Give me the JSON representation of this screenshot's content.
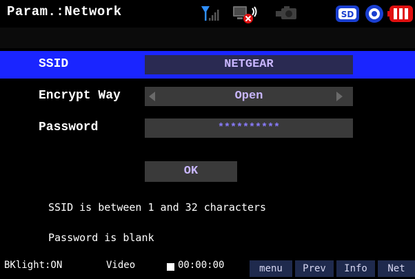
{
  "header": {
    "title": "Param.:Network",
    "icons": [
      "signal-icon",
      "monitor-disconnected-icon",
      "camera-icon",
      "sd-card-icon",
      "record-disc-icon",
      "battery-icon"
    ]
  },
  "form": {
    "ssid": {
      "label": "SSID",
      "value": "NETGEAR"
    },
    "encrypt": {
      "label": "Encrypt Way",
      "value": "Open"
    },
    "password": {
      "label": "Password",
      "value": "**********"
    }
  },
  "ok_label": "OK",
  "hints": [
    "SSID is between 1 and 32 characters",
    "Password is blank"
  ],
  "status": {
    "backlight": "BKlight:ON",
    "mode": "Video",
    "timecode": "00:00:00"
  },
  "softkeys": [
    "menu",
    "Prev",
    "Info",
    "Net"
  ],
  "colors": {
    "selected_row": "#1a25ff",
    "field_bg": "#3a3a3a",
    "value_text": "#c8b6ff",
    "softkey_bg": "#1f2a4d",
    "battery": "#e01010",
    "sd_card": "#1a3fd0"
  }
}
